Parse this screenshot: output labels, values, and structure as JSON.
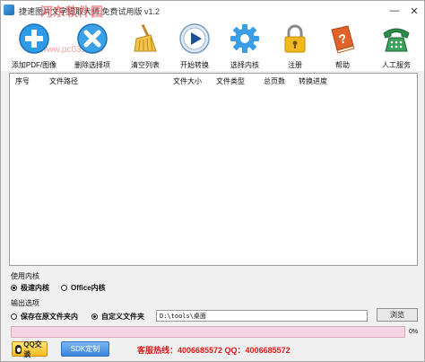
{
  "window": {
    "title": "捷速图片文字提取大师 免费试用版 v1.2",
    "watermark": "河东软件园",
    "watermark_url": "www.pc0359.cn",
    "minimize": "—",
    "close": "✕"
  },
  "toolbar": [
    {
      "label": "添加PDF/图像",
      "icon": "add-icon"
    },
    {
      "label": "删除选择项",
      "icon": "delete-icon"
    },
    {
      "label": "清空列表",
      "icon": "broom-icon"
    },
    {
      "label": "开始转换",
      "icon": "play-icon"
    },
    {
      "label": "选择内核",
      "icon": "gear-icon"
    },
    {
      "label": "注册",
      "icon": "lock-icon"
    },
    {
      "label": "帮助",
      "icon": "help-book-icon"
    },
    {
      "label": "人工服务",
      "icon": "phone-icon"
    }
  ],
  "filelist": {
    "columns": [
      "序号",
      "文件路径",
      "文件大小",
      "文件类型",
      "总页数",
      "转换进度"
    ],
    "rows": []
  },
  "engine": {
    "section_label": "使用内核",
    "options": [
      {
        "label": "极速内核",
        "selected": true
      },
      {
        "label": "Office内核",
        "selected": false
      }
    ]
  },
  "output": {
    "section_label": "输出选项",
    "options": [
      {
        "label": "保存在原文件夹内",
        "selected": false
      },
      {
        "label": "自定义文件夹",
        "selected": true
      }
    ],
    "path_value": "D:\\tools\\桌面",
    "browse_label": "浏览"
  },
  "progress": {
    "value": 0,
    "label": "0%"
  },
  "footer": {
    "qq_label": "QQ交谈",
    "sdk_label": "SDK定制",
    "hotline": "客服热线：4006685572 QQ：4006685572"
  },
  "colors": {
    "accent": "#e03a7a",
    "hotline": "#e0181b",
    "progress_bg": "#f4d3e2"
  }
}
